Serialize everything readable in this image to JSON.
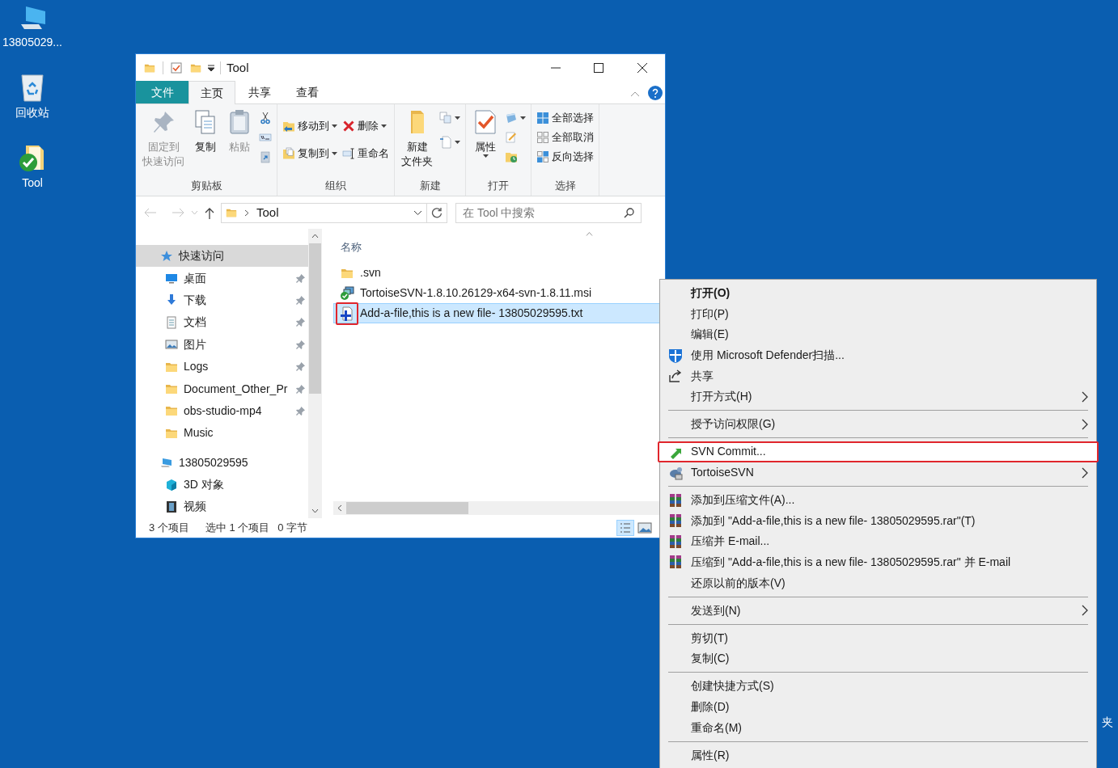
{
  "desktop_icons": [
    {
      "label": "13805029...",
      "kind": "computer"
    },
    {
      "label": "回收站",
      "kind": "recycle"
    },
    {
      "label": "Tool",
      "kind": "svn_folder"
    }
  ],
  "desktop_partial_label": "夹",
  "explorer": {
    "title": "Tool",
    "tabs": [
      {
        "label": "文件",
        "kind": "file",
        "selected": false
      },
      {
        "label": "主页",
        "kind": "tab",
        "selected": true
      },
      {
        "label": "共享",
        "kind": "tab",
        "selected": false
      },
      {
        "label": "查看",
        "kind": "tab",
        "selected": false
      }
    ],
    "ribbon": [
      {
        "label": "剪贴板",
        "large": [
          {
            "lines": [
              "固定到",
              "快速访问"
            ],
            "kind": "pin",
            "disabled": true
          },
          {
            "lines": [
              "复制"
            ],
            "kind": "copy",
            "disabled": false
          },
          {
            "lines": [
              "粘贴"
            ],
            "kind": "paste",
            "disabled": true
          }
        ],
        "columns": [
          [
            {
              "kind": "cut"
            },
            {
              "kind": "copypath"
            },
            {
              "kind": "pasteshortcut"
            }
          ]
        ]
      },
      {
        "label": "组织",
        "columns": [
          [
            {
              "label": "移动到",
              "kind": "move",
              "dropdown": true
            },
            {
              "label": "复制到",
              "kind": "copyto",
              "dropdown": true
            }
          ],
          [
            {
              "label": "删除",
              "kind": "delete",
              "dropdown": true
            },
            {
              "label": "重命名",
              "kind": "rename",
              "dropdown": false
            }
          ]
        ]
      },
      {
        "label": "新建",
        "large": [
          {
            "lines": [
              "新建",
              "文件夹"
            ],
            "kind": "folder",
            "disabled": false
          }
        ],
        "columns": [
          [
            {
              "kind": "newitem",
              "dropdown": true
            },
            {
              "kind": "easyaccess",
              "dropdown": true
            }
          ]
        ]
      },
      {
        "label": "打开",
        "large": [
          {
            "lines": [
              "属性"
            ],
            "kind": "properties",
            "disabled": false,
            "dropdown": true
          }
        ],
        "columns": [
          [
            {
              "kind": "open",
              "dropdown": true
            },
            {
              "kind": "edit"
            },
            {
              "kind": "history"
            }
          ]
        ]
      },
      {
        "label": "选择",
        "columns": [
          [
            {
              "label": "全部选择",
              "kind": "selectall"
            },
            {
              "label": "全部取消",
              "kind": "selectnone"
            },
            {
              "label": "反向选择",
              "kind": "invert"
            }
          ]
        ]
      }
    ],
    "address": "Tool",
    "search": {
      "placeholder": "在 Tool 中搜索"
    },
    "sidebar": [
      {
        "label": "快速访问",
        "kind": "star",
        "selected": true,
        "children": [
          {
            "label": "桌面",
            "kind": "desktop",
            "pinned": true
          },
          {
            "label": "下载",
            "kind": "download",
            "pinned": true
          },
          {
            "label": "文档",
            "kind": "docs",
            "pinned": true
          },
          {
            "label": "图片",
            "kind": "pictures",
            "pinned": true
          },
          {
            "label": "Logs",
            "kind": "folder",
            "pinned": true
          },
          {
            "label": "Document_Other_Pr",
            "kind": "folder",
            "pinned": true
          },
          {
            "label": "obs-studio-mp4",
            "kind": "folder",
            "pinned": true
          },
          {
            "label": "Music",
            "kind": "folder",
            "pinned": false
          }
        ]
      },
      {
        "label": "13805029595",
        "kind": "pc",
        "selected": false,
        "children": [
          {
            "label": "3D 对象",
            "kind": "cube",
            "pinned": false
          },
          {
            "label": "视频",
            "kind": "video",
            "pinned": false
          }
        ]
      }
    ],
    "column_header": "名称",
    "files": [
      {
        "name": ".svn",
        "kind": "folder",
        "selected": false,
        "highlighted": false
      },
      {
        "name": "TortoiseSVN-1.8.10.26129-x64-svn-1.8.11.msi",
        "kind": "msi",
        "selected": false,
        "highlighted": false
      },
      {
        "name": "Add-a-file,this is a new file- 13805029595.txt",
        "kind": "added",
        "selected": true,
        "highlighted": true
      }
    ],
    "status": [
      "3 个项目",
      "选中 1 个项目",
      "0 字节"
    ]
  },
  "context_menu": [
    [
      {
        "label": "打开(O)",
        "kind": "plain",
        "bold": true,
        "submenu": false,
        "highlighted": false
      },
      {
        "label": "打印(P)",
        "kind": "plain",
        "bold": false,
        "submenu": false,
        "highlighted": false
      },
      {
        "label": "编辑(E)",
        "kind": "plain",
        "bold": false,
        "submenu": false,
        "highlighted": false
      },
      {
        "label": "使用 Microsoft Defender扫描...",
        "kind": "defender",
        "bold": false,
        "submenu": false,
        "highlighted": false
      },
      {
        "label": "共享",
        "kind": "share",
        "bold": false,
        "submenu": false,
        "highlighted": false
      },
      {
        "label": "打开方式(H)",
        "kind": "plain",
        "bold": false,
        "submenu": true,
        "highlighted": false
      }
    ],
    [
      {
        "label": "授予访问权限(G)",
        "kind": "plain",
        "bold": false,
        "submenu": true,
        "highlighted": false
      }
    ],
    [
      {
        "label": "SVN Commit...",
        "kind": "commit",
        "bold": false,
        "submenu": false,
        "highlighted": true
      },
      {
        "label": "TortoiseSVN",
        "kind": "tortoise",
        "bold": false,
        "submenu": true,
        "highlighted": false
      }
    ],
    [
      {
        "label": "添加到压缩文件(A)...",
        "kind": "rar",
        "bold": false,
        "submenu": false,
        "highlighted": false
      },
      {
        "label": "添加到 \"Add-a-file,this is a new file- 13805029595.rar\"(T)",
        "kind": "rar",
        "bold": false,
        "submenu": false,
        "highlighted": false
      },
      {
        "label": "压缩并 E-mail...",
        "kind": "rar",
        "bold": false,
        "submenu": false,
        "highlighted": false
      },
      {
        "label": "压缩到 \"Add-a-file,this is a new file- 13805029595.rar\" 并 E-mail",
        "kind": "rar",
        "bold": false,
        "submenu": false,
        "highlighted": false
      },
      {
        "label": "还原以前的版本(V)",
        "kind": "plain",
        "bold": false,
        "submenu": false,
        "highlighted": false
      }
    ],
    [
      {
        "label": "发送到(N)",
        "kind": "plain",
        "bold": false,
        "submenu": true,
        "highlighted": false
      }
    ],
    [
      {
        "label": "剪切(T)",
        "kind": "plain",
        "bold": false,
        "submenu": false,
        "highlighted": false
      },
      {
        "label": "复制(C)",
        "kind": "plain",
        "bold": false,
        "submenu": false,
        "highlighted": false
      }
    ],
    [
      {
        "label": "创建快捷方式(S)",
        "kind": "plain",
        "bold": false,
        "submenu": false,
        "highlighted": false
      },
      {
        "label": "删除(D)",
        "kind": "plain",
        "bold": false,
        "submenu": false,
        "highlighted": false
      },
      {
        "label": "重命名(M)",
        "kind": "plain",
        "bold": false,
        "submenu": false,
        "highlighted": false
      }
    ],
    [
      {
        "label": "属性(R)",
        "kind": "plain",
        "bold": false,
        "submenu": false,
        "highlighted": false
      }
    ]
  ]
}
